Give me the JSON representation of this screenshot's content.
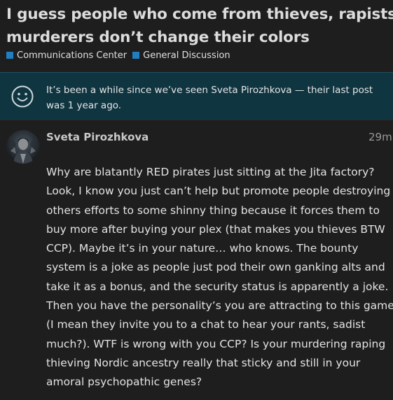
{
  "topic": {
    "title": "I guess people who come from thieves, rapists, and murderers don’t change their colors",
    "categories": [
      {
        "label": "Communications Center",
        "color": "#1f7fc2"
      },
      {
        "label": "General Discussion",
        "color": "#1f7fc2"
      }
    ]
  },
  "notice": {
    "icon": "smiley-icon",
    "text": "It’s been a while since we’ve seen Sveta Pirozhkova — their last post was 1 year ago."
  },
  "post": {
    "author": "Sveta Pirozhkova",
    "time": "29m",
    "avatar_icon": "user-avatar",
    "body": "Why are blatantly RED pirates just sitting at the Jita factory? Look, I know you just can’t help but promote people destroying others efforts to some shinny thing because it forces them to buy more after buying your plex (that makes you thieves BTW CCP). Maybe it’s in your nature… who knows. The bounty system is a joke as people just pod their own ganking alts and take it as a bonus, and the security status is apparently a joke. Then you have the personality’s you are attracting to this game (I mean they invite you to a chat to hear your rants, sadist much?). WTF is wrong with you CCP? Is your murdering raping thieving Nordic ancestry really that sticky and still in your amoral psychopathic genes?"
  },
  "colors": {
    "background": "#1e1e1e",
    "notice_background": "#0f3541",
    "category_accent": "#1f7fc2"
  }
}
